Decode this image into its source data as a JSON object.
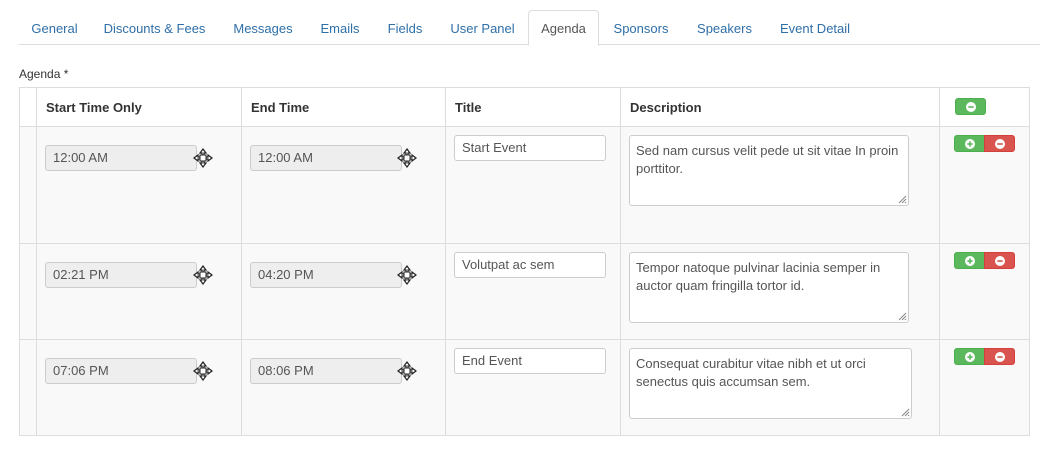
{
  "tabs": [
    {
      "label": "General"
    },
    {
      "label": "Discounts & Fees"
    },
    {
      "label": "Messages"
    },
    {
      "label": "Emails"
    },
    {
      "label": "Fields"
    },
    {
      "label": "User Panel"
    },
    {
      "label": "Agenda",
      "active": true
    },
    {
      "label": "Sponsors"
    },
    {
      "label": "Speakers"
    },
    {
      "label": "Event Detail"
    }
  ],
  "agenda": {
    "label": "Agenda *",
    "columns": {
      "start": "Start Time Only",
      "end": "End Time",
      "title": "Title",
      "description": "Description"
    },
    "rows": [
      {
        "start": "12:00 AM",
        "end": "12:00 AM",
        "title": "Start Event",
        "description": "Sed nam cursus velit pede ut sit vitae In proin porttitor."
      },
      {
        "start": "02:21 PM",
        "end": "04:20 PM",
        "title": "Volutpat ac sem",
        "description": "Tempor natoque pulvinar lacinia semper in auctor quam fringilla tortor id."
      },
      {
        "start": "07:06 PM",
        "end": "08:06 PM",
        "title": "End Event",
        "description": "Consequat curabitur vitae nibh et ut orci senectus quis accumsan sem."
      }
    ]
  },
  "icons": {
    "move": "move-icon",
    "add": "plus-circle-icon",
    "remove": "minus-circle-icon"
  },
  "colors": {
    "tab_link": "#2f6fa8",
    "add_button": "#5cb85c",
    "remove_button": "#d9534f"
  }
}
